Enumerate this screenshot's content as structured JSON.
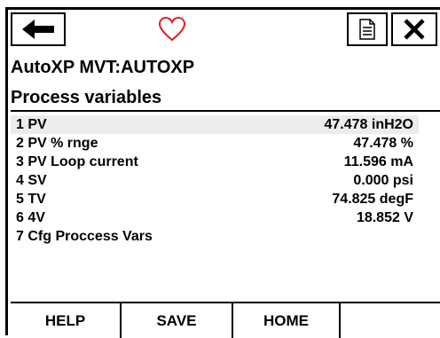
{
  "toolbar": {
    "back_icon": "arrow-left-icon",
    "favorite_icon": "heart-icon",
    "document_icon": "document-icon",
    "close_icon": "close-icon"
  },
  "header": {
    "device_title": "AutoXP MVT:AUTOXP",
    "page_title": "Process variables"
  },
  "list": {
    "items": [
      {
        "label": "1 PV",
        "value": "47.478 inH2O"
      },
      {
        "label": "2 PV % rnge",
        "value": "47.478 %"
      },
      {
        "label": "3 PV Loop current",
        "value": "11.596 mA"
      },
      {
        "label": "4 SV",
        "value": "0.000 psi"
      },
      {
        "label": "5 TV",
        "value": "74.825 degF"
      },
      {
        "label": "6 4V",
        "value": "18.852 V"
      },
      {
        "label": "7 Cfg Proccess Vars",
        "value": ""
      }
    ]
  },
  "buttons": {
    "help": "HELP",
    "save": "SAVE",
    "home": "HOME"
  },
  "colors": {
    "heart": "#e02020",
    "selected_row": "#ececec",
    "border": "#000000"
  }
}
